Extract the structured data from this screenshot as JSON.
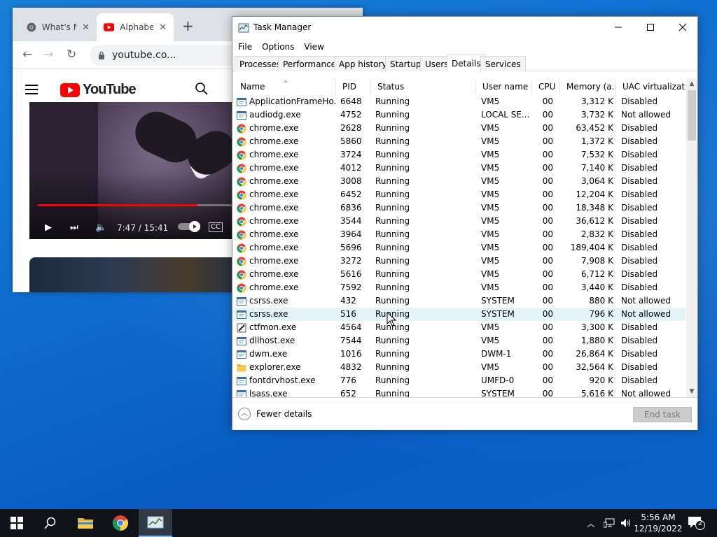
{
  "chrome": {
    "tabs": [
      {
        "title": "What's N",
        "active": false
      },
      {
        "title": "Alphabe",
        "active": true
      }
    ],
    "url": "youtube.co...",
    "yt_wordmark": "YouTube",
    "video_time": "7:47 / 15:41",
    "progress_fraction": 0.82
  },
  "taskmanager": {
    "title": "Task Manager",
    "menu": [
      "File",
      "Options",
      "View"
    ],
    "tabs": [
      "Processes",
      "Performance",
      "App history",
      "Startup",
      "Users",
      "Details",
      "Services"
    ],
    "active_tab": "Details",
    "columns": {
      "name": "Name",
      "pid": "PID",
      "status": "Status",
      "user": "User name",
      "cpu": "CPU",
      "mem": "Memory (a...",
      "uac": "UAC virtualizat..."
    },
    "rows": [
      {
        "icon": "app",
        "name": "ApplicationFrameHo...",
        "pid": "6648",
        "status": "Running",
        "user": "VM5",
        "cpu": "00",
        "mem": "3,312 K",
        "uac": "Disabled"
      },
      {
        "icon": "app",
        "name": "audiodg.exe",
        "pid": "4752",
        "status": "Running",
        "user": "LOCAL SE...",
        "cpu": "00",
        "mem": "3,732 K",
        "uac": "Not allowed"
      },
      {
        "icon": "chrome",
        "name": "chrome.exe",
        "pid": "2628",
        "status": "Running",
        "user": "VM5",
        "cpu": "00",
        "mem": "63,452 K",
        "uac": "Disabled"
      },
      {
        "icon": "chrome",
        "name": "chrome.exe",
        "pid": "5860",
        "status": "Running",
        "user": "VM5",
        "cpu": "00",
        "mem": "1,372 K",
        "uac": "Disabled"
      },
      {
        "icon": "chrome",
        "name": "chrome.exe",
        "pid": "3724",
        "status": "Running",
        "user": "VM5",
        "cpu": "00",
        "mem": "7,532 K",
        "uac": "Disabled"
      },
      {
        "icon": "chrome",
        "name": "chrome.exe",
        "pid": "4012",
        "status": "Running",
        "user": "VM5",
        "cpu": "00",
        "mem": "7,140 K",
        "uac": "Disabled"
      },
      {
        "icon": "chrome",
        "name": "chrome.exe",
        "pid": "3008",
        "status": "Running",
        "user": "VM5",
        "cpu": "00",
        "mem": "3,064 K",
        "uac": "Disabled"
      },
      {
        "icon": "chrome",
        "name": "chrome.exe",
        "pid": "6452",
        "status": "Running",
        "user": "VM5",
        "cpu": "00",
        "mem": "12,204 K",
        "uac": "Disabled"
      },
      {
        "icon": "chrome",
        "name": "chrome.exe",
        "pid": "6836",
        "status": "Running",
        "user": "VM5",
        "cpu": "00",
        "mem": "18,348 K",
        "uac": "Disabled"
      },
      {
        "icon": "chrome",
        "name": "chrome.exe",
        "pid": "3544",
        "status": "Running",
        "user": "VM5",
        "cpu": "00",
        "mem": "36,612 K",
        "uac": "Disabled"
      },
      {
        "icon": "chrome",
        "name": "chrome.exe",
        "pid": "3964",
        "status": "Running",
        "user": "VM5",
        "cpu": "00",
        "mem": "2,832 K",
        "uac": "Disabled"
      },
      {
        "icon": "chrome",
        "name": "chrome.exe",
        "pid": "5696",
        "status": "Running",
        "user": "VM5",
        "cpu": "00",
        "mem": "189,404 K",
        "uac": "Disabled"
      },
      {
        "icon": "chrome",
        "name": "chrome.exe",
        "pid": "3272",
        "status": "Running",
        "user": "VM5",
        "cpu": "00",
        "mem": "7,908 K",
        "uac": "Disabled"
      },
      {
        "icon": "chrome",
        "name": "chrome.exe",
        "pid": "5616",
        "status": "Running",
        "user": "VM5",
        "cpu": "00",
        "mem": "6,712 K",
        "uac": "Disabled"
      },
      {
        "icon": "chrome",
        "name": "chrome.exe",
        "pid": "7592",
        "status": "Running",
        "user": "VM5",
        "cpu": "00",
        "mem": "3,440 K",
        "uac": "Disabled"
      },
      {
        "icon": "app",
        "name": "csrss.exe",
        "pid": "432",
        "status": "Running",
        "user": "SYSTEM",
        "cpu": "00",
        "mem": "880 K",
        "uac": "Not allowed"
      },
      {
        "icon": "app",
        "name": "csrss.exe",
        "pid": "516",
        "status": "Running",
        "user": "SYSTEM",
        "cpu": "00",
        "mem": "796 K",
        "uac": "Not allowed",
        "selected": true
      },
      {
        "icon": "pen",
        "name": "ctfmon.exe",
        "pid": "4564",
        "status": "Running",
        "user": "VM5",
        "cpu": "00",
        "mem": "3,300 K",
        "uac": "Disabled"
      },
      {
        "icon": "app",
        "name": "dllhost.exe",
        "pid": "7544",
        "status": "Running",
        "user": "VM5",
        "cpu": "00",
        "mem": "1,880 K",
        "uac": "Disabled"
      },
      {
        "icon": "app",
        "name": "dwm.exe",
        "pid": "1016",
        "status": "Running",
        "user": "DWM-1",
        "cpu": "00",
        "mem": "26,864 K",
        "uac": "Disabled"
      },
      {
        "icon": "folder",
        "name": "explorer.exe",
        "pid": "4832",
        "status": "Running",
        "user": "VM5",
        "cpu": "00",
        "mem": "32,564 K",
        "uac": "Disabled"
      },
      {
        "icon": "app",
        "name": "fontdrvhost.exe",
        "pid": "776",
        "status": "Running",
        "user": "UMFD-0",
        "cpu": "00",
        "mem": "920 K",
        "uac": "Disabled"
      },
      {
        "icon": "app",
        "name": "lsass.exe",
        "pid": "652",
        "status": "Running",
        "user": "SYSTEM",
        "cpu": "00",
        "mem": "5,616 K",
        "uac": "Not allowed"
      }
    ],
    "fewer_details": "Fewer details",
    "end_task": "End task"
  },
  "taskbar": {
    "time": "5:56 AM",
    "date": "12/19/2022",
    "notification_count": "2"
  }
}
